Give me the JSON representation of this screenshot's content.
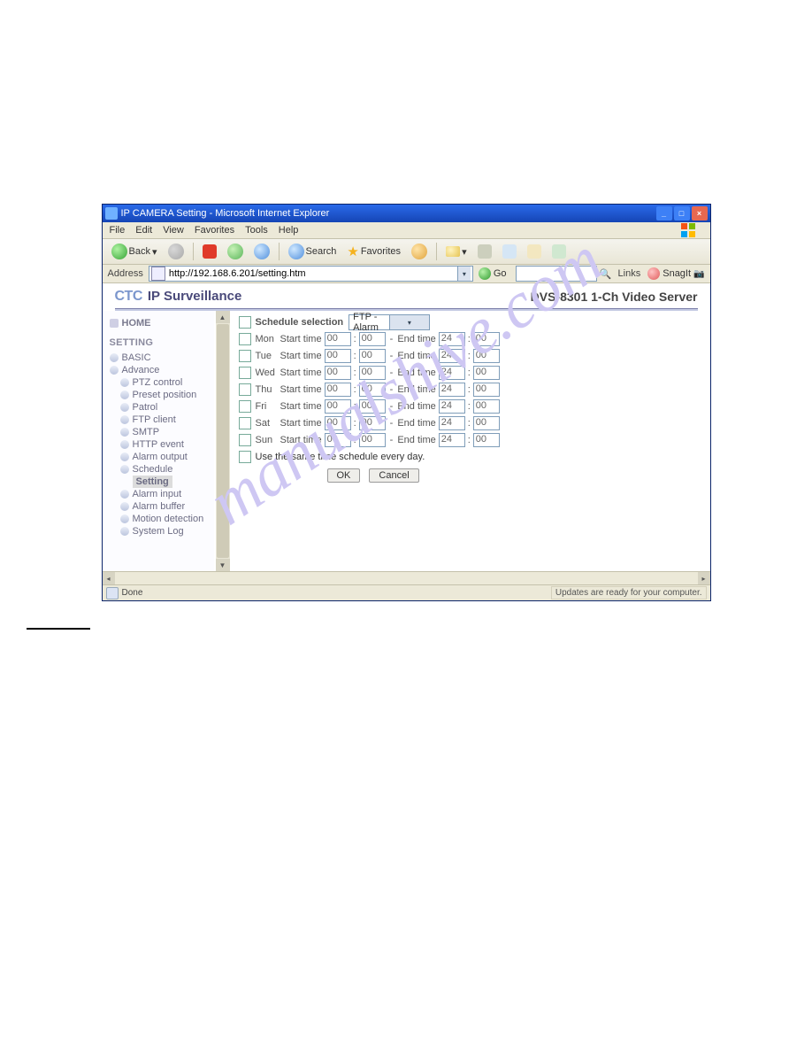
{
  "window": {
    "title": "IP CAMERA Setting - Microsoft Internet Explorer"
  },
  "menu": {
    "items": [
      "File",
      "Edit",
      "View",
      "Favorites",
      "Tools",
      "Help"
    ]
  },
  "toolbar": {
    "back": "Back",
    "search": "Search",
    "favorites": "Favorites"
  },
  "address": {
    "label": "Address",
    "value": "http://192.168.6.201/setting.htm",
    "go": "Go",
    "links": "Links",
    "snagit": "SnagIt"
  },
  "header": {
    "brand1": "CTC",
    "brand2": "IP Surveillance",
    "product": "DVS-8301 1-Ch Video Server"
  },
  "sidebar": {
    "home": "HOME",
    "setting": "SETTING",
    "basic": "BASIC",
    "advance": "Advance",
    "items": [
      "PTZ control",
      "Preset position",
      "Patrol",
      "FTP client",
      "SMTP",
      "HTTP event",
      "Alarm output",
      "Schedule"
    ],
    "selected": "Setting",
    "tail": [
      "Alarm input",
      "Alarm buffer",
      "Motion detection",
      "System Log"
    ]
  },
  "schedule": {
    "label": "Schedule selection",
    "dropdown": "FTP - Alarm",
    "days": [
      "Mon",
      "Tue",
      "Wed",
      "Thu",
      "Fri",
      "Sat",
      "Sun"
    ],
    "start": "Start time",
    "end": "End time",
    "start_h": "00",
    "start_m": "00",
    "end_h": "24",
    "end_m": "00",
    "same": "Use the same time schedule every day.",
    "ok": "OK",
    "cancel": "Cancel"
  },
  "status": {
    "done": "Done",
    "updates": "Updates are ready for your computer."
  },
  "watermark": "manualshive.com"
}
